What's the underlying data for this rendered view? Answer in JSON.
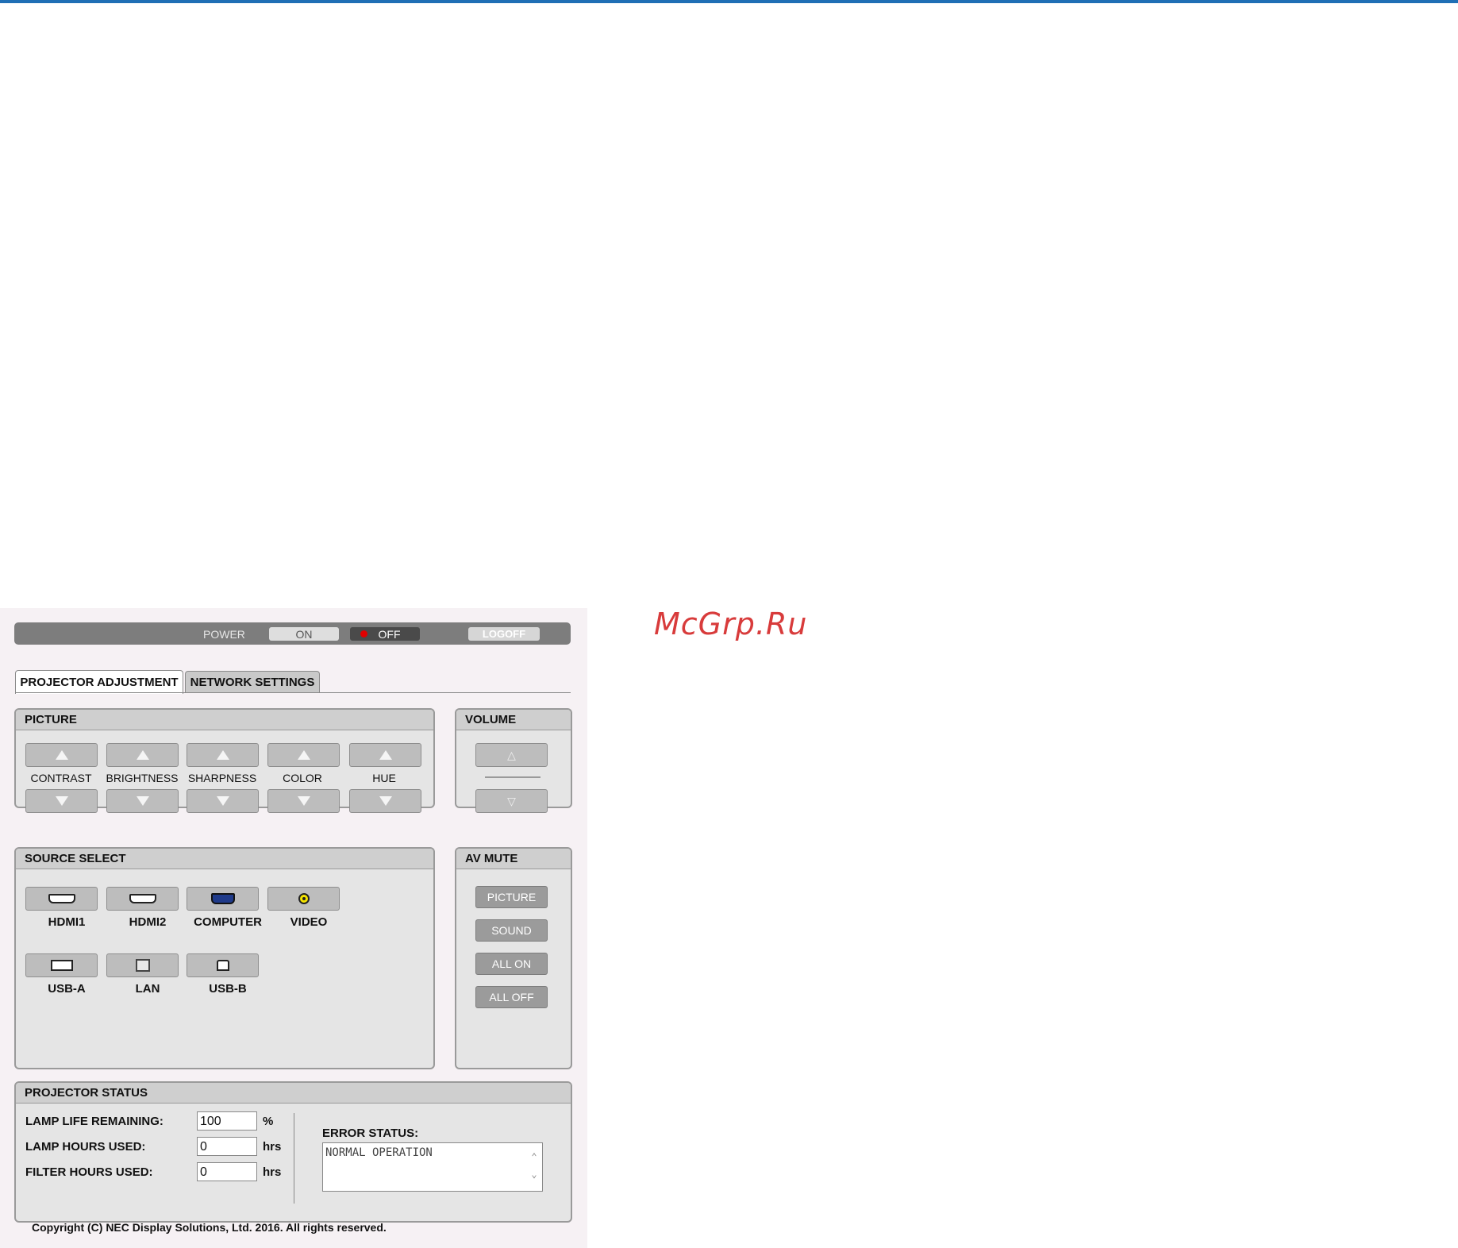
{
  "watermark": "McGrp.Ru",
  "power": {
    "label": "POWER",
    "on_label": "ON",
    "off_label": "OFF",
    "logoff_label": "LOGOFF"
  },
  "tabs": [
    {
      "label": "PROJECTOR ADJUSTMENT",
      "active": true
    },
    {
      "label": "NETWORK SETTINGS",
      "active": false
    }
  ],
  "picture": {
    "title": "PICTURE",
    "controls": [
      "CONTRAST",
      "BRIGHTNESS",
      "SHARPNESS",
      "COLOR",
      "HUE"
    ]
  },
  "volume": {
    "title": "VOLUME"
  },
  "source_select": {
    "title": "SOURCE SELECT",
    "sources": [
      "HDMI1",
      "HDMI2",
      "COMPUTER",
      "VIDEO",
      "USB-A",
      "LAN",
      "USB-B"
    ]
  },
  "av_mute": {
    "title": "AV MUTE",
    "buttons": [
      "PICTURE",
      "SOUND",
      "ALL ON",
      "ALL OFF"
    ]
  },
  "status": {
    "title": "PROJECTOR STATUS",
    "lamp_life_label": "LAMP LIFE REMAINING:",
    "lamp_life_value": "100",
    "lamp_life_unit": "%",
    "lamp_hours_label": "LAMP HOURS USED:",
    "lamp_hours_value": "0",
    "lamp_hours_unit": "hrs",
    "filter_hours_label": "FILTER HOURS USED:",
    "filter_hours_value": "0",
    "filter_hours_unit": "hrs",
    "error_label": "ERROR STATUS:",
    "error_value": "NORMAL OPERATION"
  },
  "copyright": "Copyright (C) NEC Display Solutions, Ltd. 2016. All rights reserved.",
  "colors": {
    "top_line": "#1f6fb5",
    "watermark": "#d83b3b",
    "power_off_indicator": "#e00000"
  }
}
